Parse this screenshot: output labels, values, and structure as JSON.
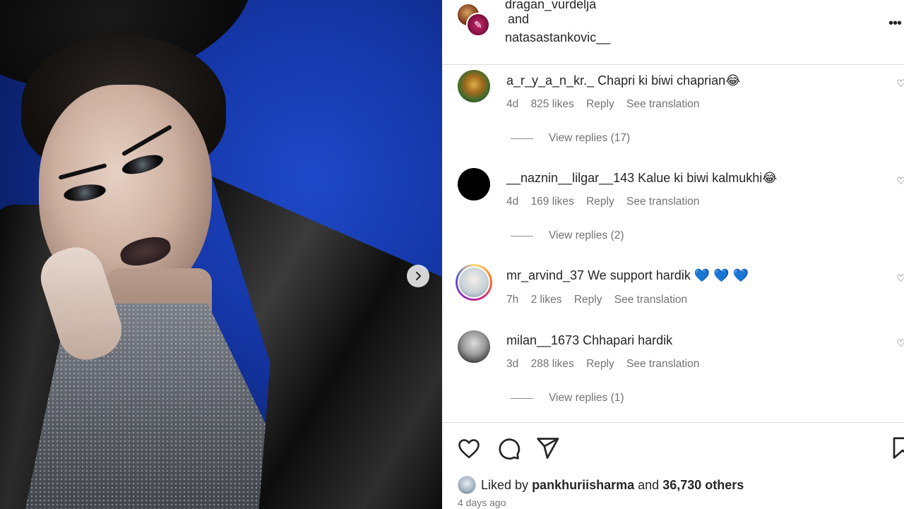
{
  "post": {
    "photo_alt": "",
    "next_arrow": "chevron-right-icon"
  },
  "header": {
    "user1": "dragan_vurdelja",
    "and": "and",
    "user2": "natasastankovic__",
    "more": "•••"
  },
  "comments": [
    {
      "username": "a_r_y_a_n_kr._",
      "text": "Chapri ki biwi chaprian😂",
      "time": "4d",
      "likes": "825 likes",
      "reply": "Reply",
      "translate": "See translation",
      "view_replies": "View replies (17)"
    },
    {
      "username": "__naznin__lilgar__143",
      "text": "Kalue ki biwi kalmukhi😂",
      "time": "4d",
      "likes": "169 likes",
      "reply": "Reply",
      "translate": "See translation",
      "view_replies": "View replies (2)"
    },
    {
      "username": "mr_arvind_37",
      "text": "We support hardik 💙 💙 💙",
      "time": "7h",
      "likes": "2 likes",
      "reply": "Reply",
      "translate": "See translation"
    },
    {
      "username": "milan__1673",
      "text": "Chhapari hardik",
      "time": "3d",
      "likes": "288 likes",
      "reply": "Reply",
      "translate": "See translation",
      "view_replies": "View replies (1)"
    }
  ],
  "actions": {
    "like": "heart-icon",
    "comment": "comment-icon",
    "share": "share-icon",
    "save": "bookmark-icon"
  },
  "liked_by": {
    "prefix": "Liked by",
    "user": "pankhuriisharma",
    "middle": "and",
    "others": "36,730 others"
  },
  "date": "4 days ago",
  "colors": {
    "text": "#262626",
    "secondary": "#737373",
    "border": "#dbdbdb"
  }
}
